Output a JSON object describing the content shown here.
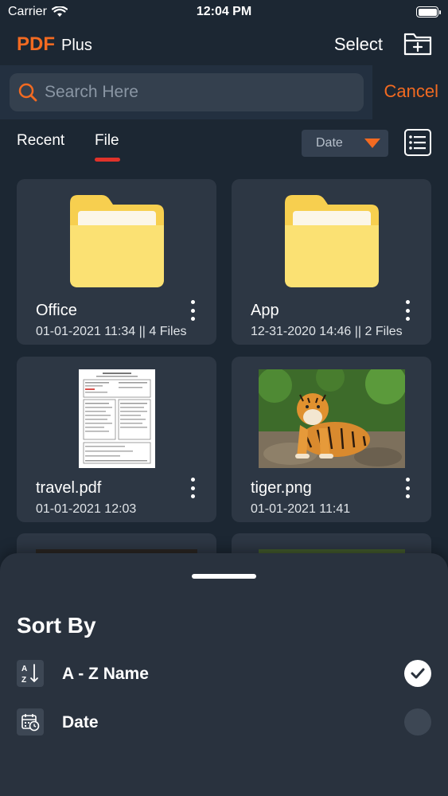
{
  "status_bar": {
    "carrier": "Carrier",
    "time": "12:04 PM"
  },
  "header": {
    "logo_pdf": "PDF",
    "logo_plus": "Plus",
    "select_label": "Select",
    "new_folder_icon": "folder-plus-icon"
  },
  "search": {
    "placeholder": "Search Here",
    "value": "",
    "cancel_label": "Cancel"
  },
  "tabs": [
    {
      "label": "Recent",
      "active": false
    },
    {
      "label": "File",
      "active": true
    }
  ],
  "sort_dropdown": {
    "selected": "Date"
  },
  "files": [
    {
      "name": "Office",
      "meta": "01-01-2021 11:34 || 4 Files",
      "type": "folder"
    },
    {
      "name": "App",
      "meta": "12-31-2020 14:46 || 2 Files",
      "type": "folder"
    },
    {
      "name": "travel.pdf",
      "meta": "01-01-2021 12:03",
      "type": "pdf"
    },
    {
      "name": "tiger.png",
      "meta": "01-01-2021 11:41",
      "type": "image"
    }
  ],
  "sort_sheet": {
    "title": "Sort By",
    "options": [
      {
        "label": "A - Z Name",
        "icon": "sort-az-icon",
        "selected": true
      },
      {
        "label": "Date",
        "icon": "calendar-clock-icon",
        "selected": false
      }
    ]
  },
  "colors": {
    "accent": "#f26a21",
    "background": "#1c2733",
    "card": "#2d3744",
    "folder": "#f8d55b",
    "tab_underline": "#e0322a"
  }
}
